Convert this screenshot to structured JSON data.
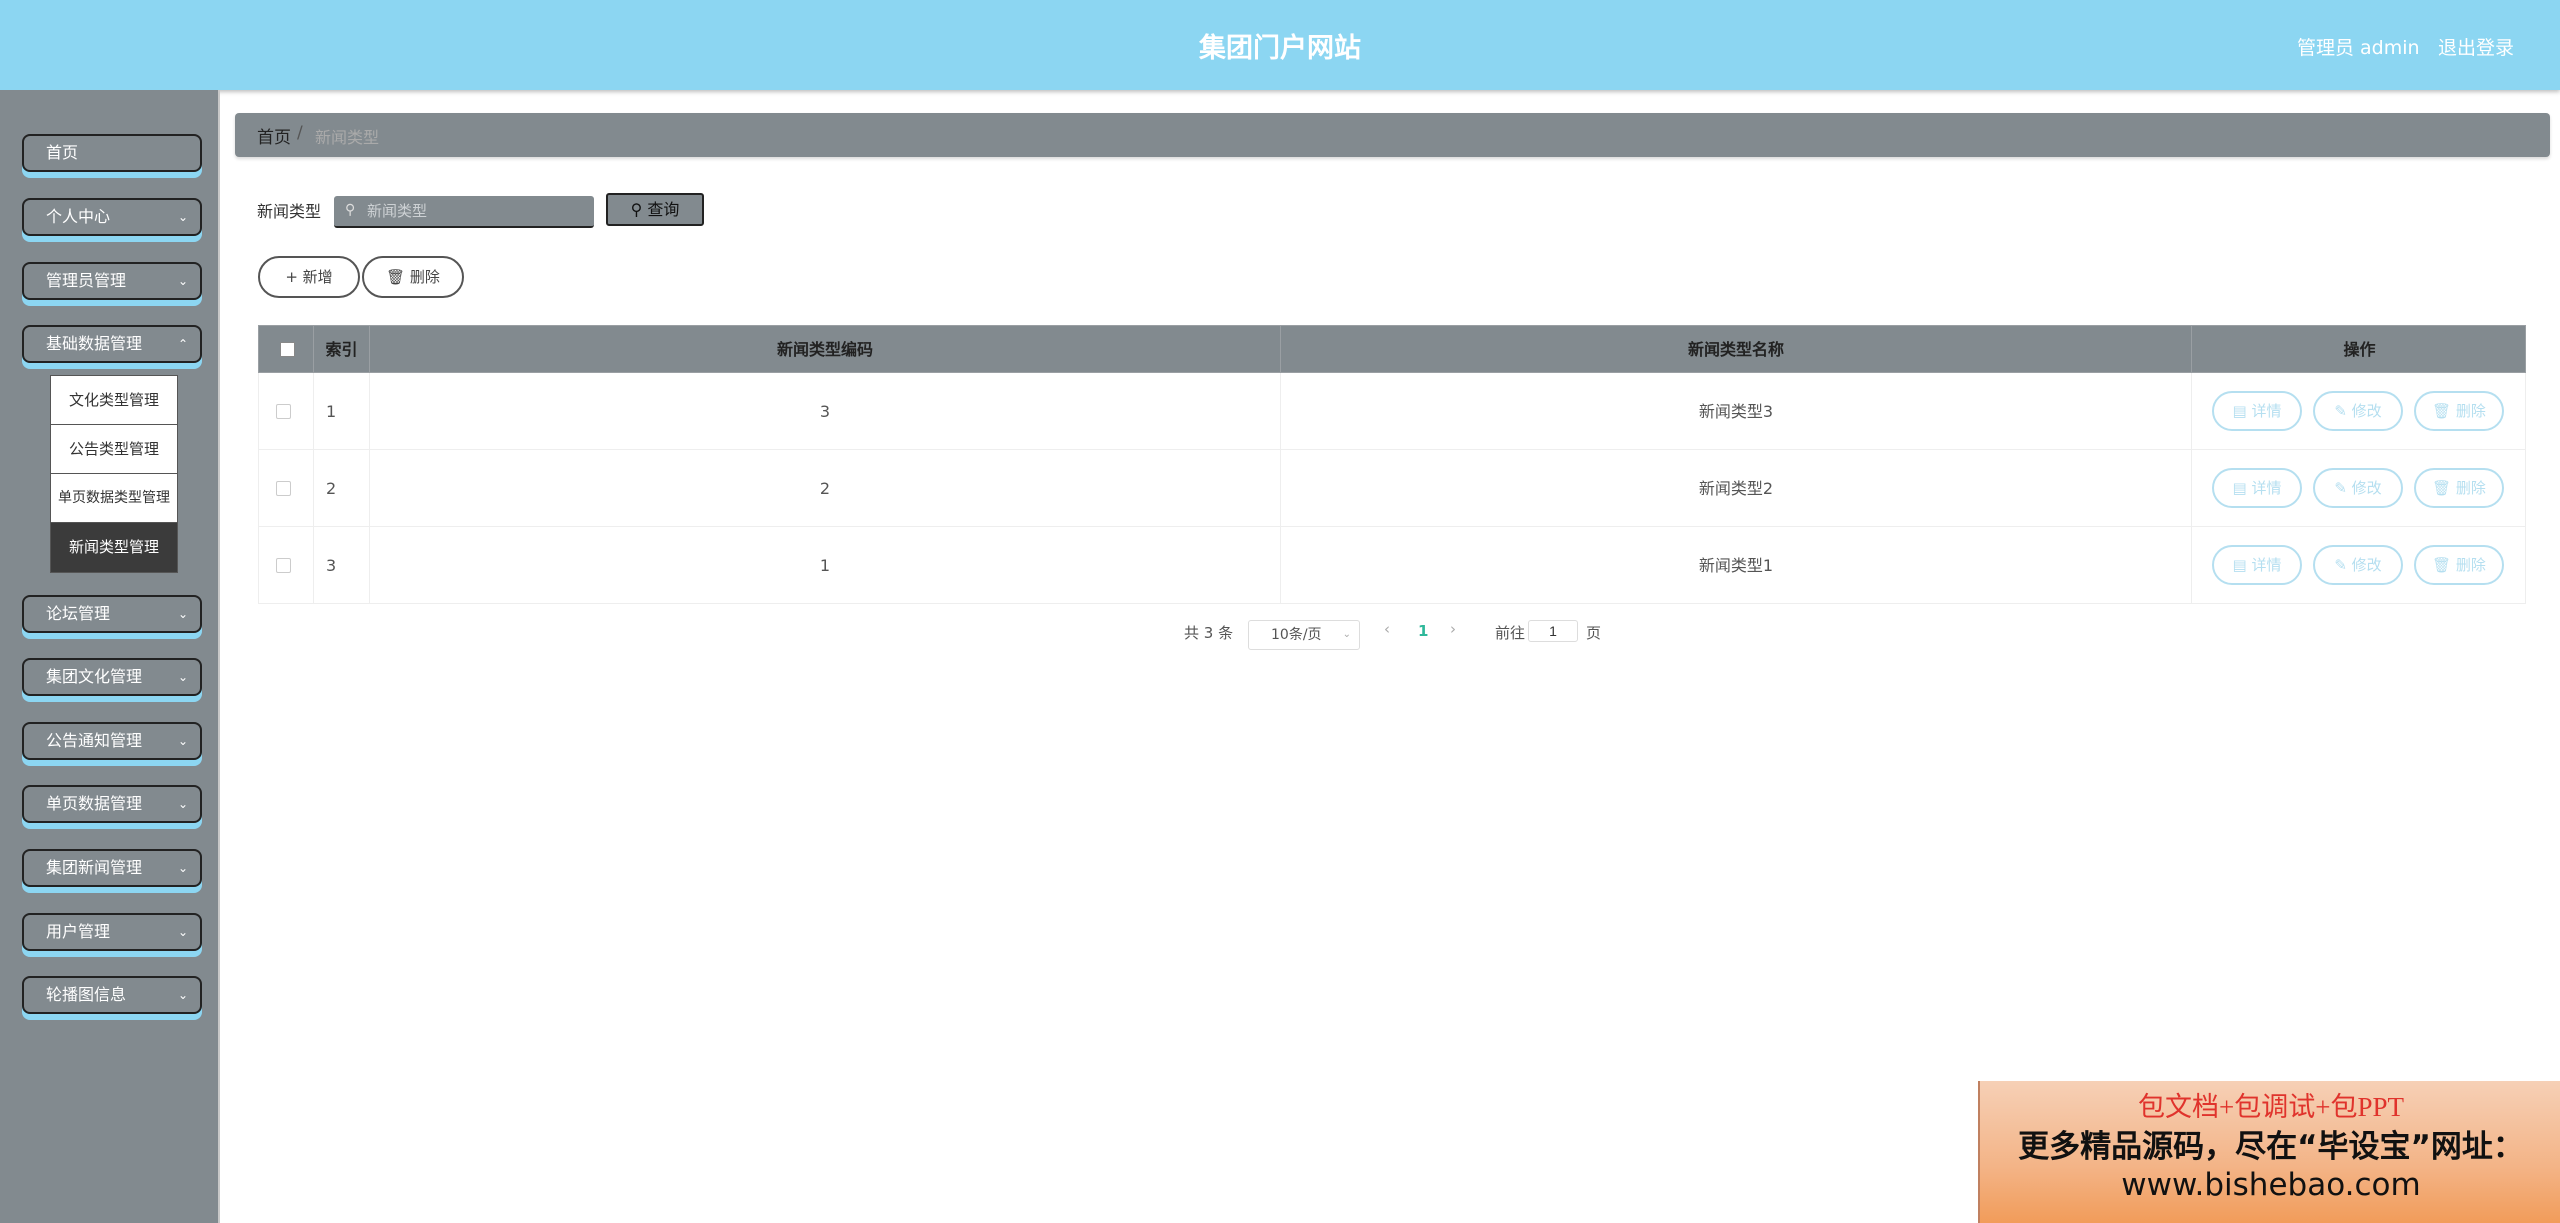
{
  "header": {
    "title": "集团门户网站",
    "user_label": "管理员 admin",
    "logout_label": "退出登录"
  },
  "sidebar": {
    "items": [
      {
        "label": "首页",
        "has_submenu": false
      },
      {
        "label": "个人中心",
        "has_submenu": true
      },
      {
        "label": "管理员管理",
        "has_submenu": true
      },
      {
        "label": "基础数据管理",
        "has_submenu": true
      },
      {
        "label": "论坛管理",
        "has_submenu": true
      },
      {
        "label": "集团文化管理",
        "has_submenu": true
      },
      {
        "label": "公告通知管理",
        "has_submenu": true
      },
      {
        "label": "单页数据管理",
        "has_submenu": true
      },
      {
        "label": "集团新闻管理",
        "has_submenu": true
      },
      {
        "label": "用户管理",
        "has_submenu": true
      },
      {
        "label": "轮播图信息",
        "has_submenu": true
      }
    ],
    "submenu": [
      {
        "label": "文化类型管理"
      },
      {
        "label": "公告类型管理"
      },
      {
        "label": "单页数据类型管理"
      },
      {
        "label": "新闻类型管理",
        "active": true
      }
    ]
  },
  "breadcrumb": {
    "home": "首页",
    "separator": "/",
    "current": "新闻类型"
  },
  "search": {
    "label": "新闻类型",
    "placeholder": "新闻类型",
    "button_label": "查询"
  },
  "actions": {
    "add_label": "新增",
    "delete_label": "删除"
  },
  "table": {
    "columns": [
      "索引",
      "新闻类型编码",
      "新闻类型名称",
      "操作"
    ],
    "rows": [
      {
        "index": "1",
        "code": "3",
        "name": "新闻类型3"
      },
      {
        "index": "2",
        "code": "2",
        "name": "新闻类型2"
      },
      {
        "index": "3",
        "code": "1",
        "name": "新闻类型1"
      }
    ],
    "row_actions": {
      "detail": "详情",
      "edit": "修改",
      "delete": "删除"
    }
  },
  "pagination": {
    "total_text": "共 3 条",
    "page_size": "10条/页",
    "current_page": "1",
    "goto_label": "前往",
    "goto_value": "1",
    "page_suffix": "页"
  },
  "promo": {
    "line1": "包文档+包调试+包PPT",
    "line2": "更多精品源码，尽在“毕设宝”网址：",
    "line3": "www.bishebao.com"
  },
  "colors": {
    "header_bg": "#8cd6f2",
    "sidebar_bg": "#828a8f",
    "accent": "#8cd6f2",
    "table_header_bg": "#828a8f",
    "op_button_border": "#b5dff0",
    "active_page": "#2fb89a"
  }
}
